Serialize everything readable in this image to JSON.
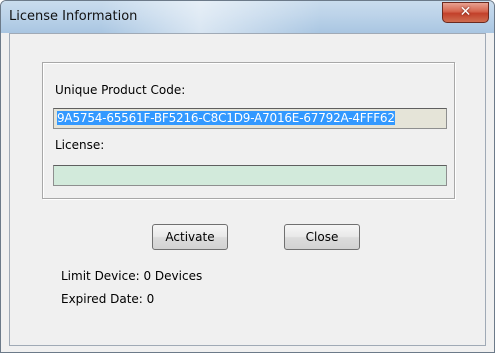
{
  "window": {
    "title": "License Information",
    "close_glyph": "✕"
  },
  "form": {
    "product_code_label": "Unique Product Code:",
    "product_code_value": "9A5754-65561F-BF5216-C8C1D9-A7016E-67792A-4FFF62",
    "license_label": "License:",
    "license_value": ""
  },
  "buttons": {
    "activate_label": "Activate",
    "close_label": "Close"
  },
  "info": {
    "limit_device": "Limit Device: 0 Devices",
    "expired_date": "Expired Date: 0"
  },
  "colors": {
    "selection": "#3399ff",
    "license_field_bg": "#d2eadb",
    "readonly_field_bg": "#e5e4d8",
    "close_button": "#c2402a"
  }
}
